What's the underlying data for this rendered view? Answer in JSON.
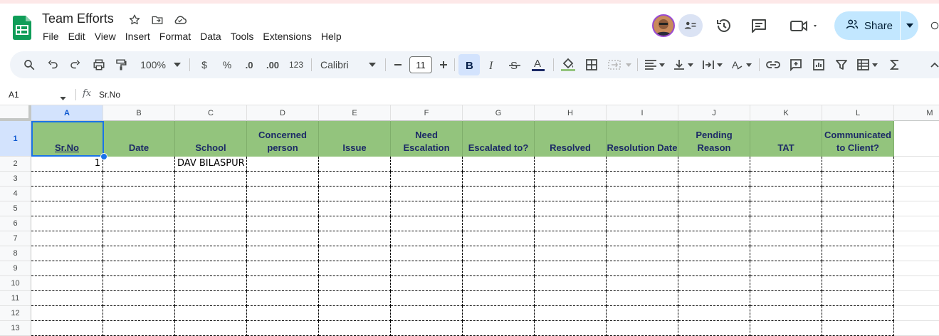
{
  "app": {
    "doc_title": "Team Efforts",
    "menu": [
      "File",
      "Edit",
      "View",
      "Insert",
      "Format",
      "Data",
      "Tools",
      "Extensions",
      "Help"
    ],
    "share_label": "Share"
  },
  "toolbar": {
    "zoom": "100%",
    "currency": "$",
    "percent": "%",
    "dec_decrease": ".0",
    "dec_increase": ".00",
    "number_format": "123",
    "font": "Calibri",
    "font_size": "11"
  },
  "formula_bar": {
    "cell_ref": "A1",
    "fx_symbol": "fx",
    "content": "Sr.No"
  },
  "sheet": {
    "columns": [
      "A",
      "B",
      "C",
      "D",
      "E",
      "F",
      "G",
      "H",
      "I",
      "J",
      "K",
      "L",
      "M"
    ],
    "rows": [
      "1",
      "2",
      "3",
      "4",
      "5",
      "6",
      "7",
      "8",
      "9",
      "10",
      "11",
      "12",
      "13"
    ],
    "headers": [
      "Sr.No",
      "Date",
      "School",
      "Concerned person",
      "Issue",
      "Need Escalation",
      "Escalated to?",
      "Resolved",
      "Resolution Date",
      "Pending Reason",
      "TAT",
      "Communicated to Client?"
    ],
    "row2": [
      "1",
      "",
      "DAV BILASPUR",
      "",
      "",
      "",
      "",
      "",
      "",
      "",
      "",
      ""
    ],
    "header_fill": "#93c47d",
    "header_text_color": "#1c2a66",
    "selection_color": "#1a73e8"
  },
  "icons": {
    "search": "search-icon",
    "undo": "undo-icon",
    "redo": "redo-icon",
    "print": "print-icon",
    "paint_format": "paint-format-icon",
    "star": "star-icon",
    "move": "move-to-folder-icon",
    "cloud": "cloud-status-icon",
    "history": "history-icon",
    "comments": "comments-icon",
    "meet": "meet-icon",
    "share": "share-people-icon"
  }
}
